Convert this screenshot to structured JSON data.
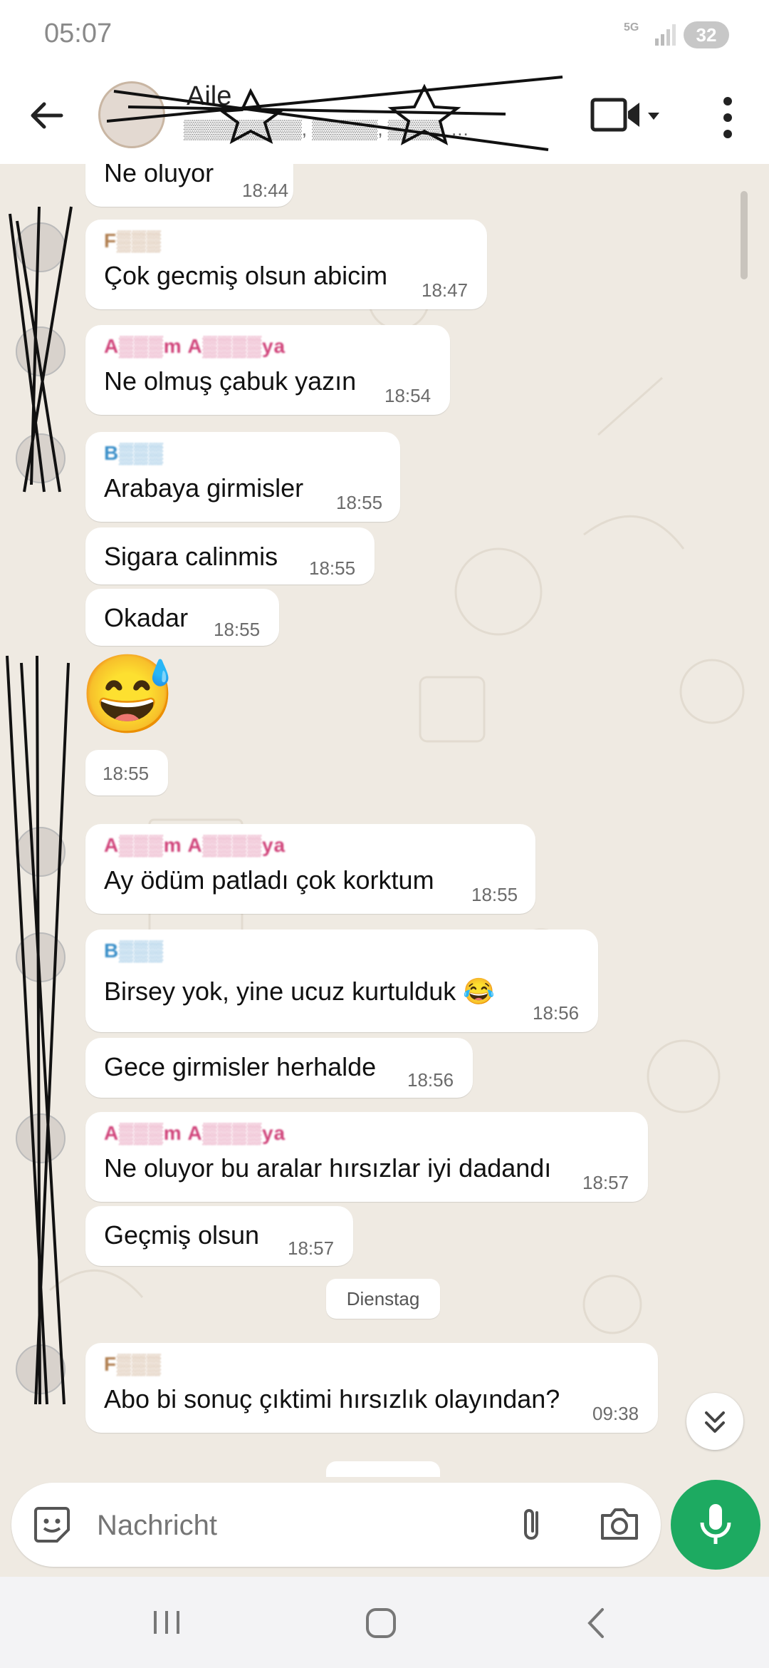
{
  "status_bar": {
    "time": "05:07",
    "network": "5G",
    "battery": "32"
  },
  "header": {
    "title": "Aile",
    "subtitle": "▒▒▒▒▒▒▒▒▒, ▒▒▒▒▒, ▒▒▒▒, …"
  },
  "messages": [
    {
      "text": "Ne oluyor",
      "time": "18:44"
    },
    {
      "sender": "F▒▒▒",
      "sender_color": "#b07e4f",
      "text": "Çok gecmiş olsun abicim",
      "time": "18:47"
    },
    {
      "sender": "A▒▒▒m A▒▒▒▒ya",
      "sender_color": "#d0437a",
      "text": "Ne olmuş çabuk yazın",
      "time": "18:54"
    },
    {
      "sender": "B▒▒▒",
      "sender_color": "#3a8fc9",
      "text": "Arabaya girmisler",
      "time": "18:55"
    },
    {
      "text": "Sigara calinmis",
      "time": "18:55"
    },
    {
      "text": "Okadar",
      "time": "18:55"
    },
    {
      "emoji": "😅",
      "time": "18:55"
    },
    {
      "sender": "A▒▒▒m A▒▒▒▒ya",
      "sender_color": "#d0437a",
      "text": "Ay ödüm patladı çok korktum",
      "time": "18:55"
    },
    {
      "sender": "B▒▒▒",
      "sender_color": "#3a8fc9",
      "text": "Birsey yok, yine ucuz kurtulduk 😂",
      "time": "18:56"
    },
    {
      "text": "Gece girmisler herhalde",
      "time": "18:56"
    },
    {
      "sender": "A▒▒▒m A▒▒▒▒ya",
      "sender_color": "#d0437a",
      "text": "Ne oluyor bu aralar hırsızlar iyi dadandı",
      "time": "18:57"
    },
    {
      "text": "Geçmiş olsun",
      "time": "18:57"
    },
    {
      "sender": "F▒▒▒",
      "sender_color": "#b07e4f",
      "text": "Abo bi sonuç çıktimi hırsızlık olayından?",
      "time": "09:38"
    }
  ],
  "date_separator": "Dienstag",
  "composer": {
    "placeholder": "Nachricht"
  },
  "colors": {
    "chat_bg": "#efeae2",
    "bubble": "#ffffff",
    "accent_green": "#1daa61"
  },
  "icons": [
    "back-arrow-icon",
    "video-call-icon",
    "more-options-icon",
    "sticker-icon",
    "attach-icon",
    "camera-icon",
    "mic-icon",
    "scroll-down-icon",
    "nav-recent-icon",
    "nav-home-icon",
    "nav-back-icon"
  ]
}
